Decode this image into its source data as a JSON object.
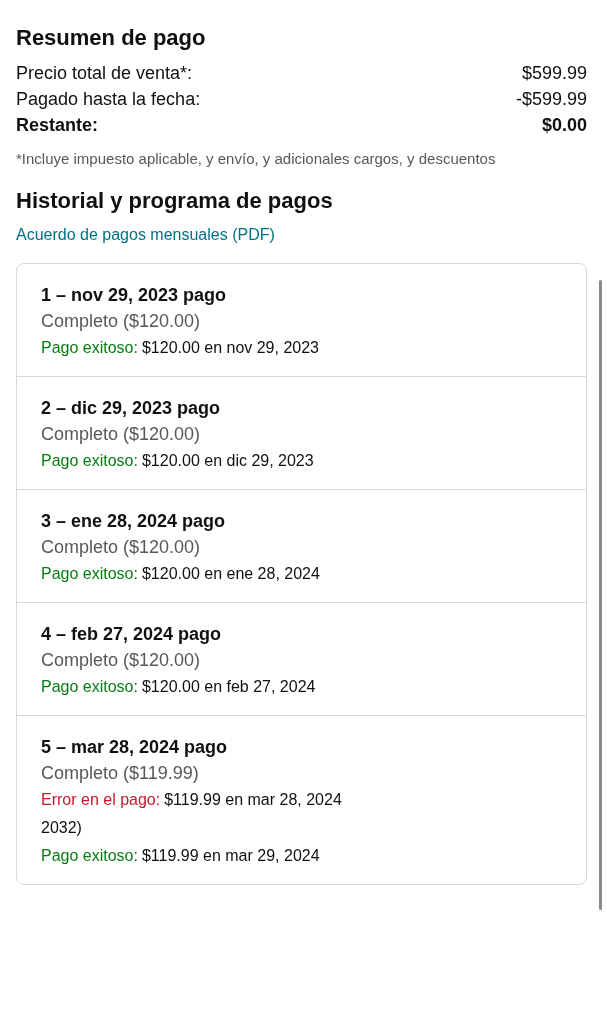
{
  "summary": {
    "title": "Resumen de pago",
    "rows": [
      {
        "label": "Precio total de venta*:",
        "value": "$599.99",
        "bold": false
      },
      {
        "label": "Pagado hasta la fecha:",
        "value": "-$599.99",
        "bold": false
      },
      {
        "label": "Restante:",
        "value": "$0.00",
        "bold": true
      }
    ],
    "footnote": "*Incluye impuesto aplicable, y envío, y adicionales cargos, y descuentos"
  },
  "history": {
    "title": "Historial y programa de pagos",
    "link": "Acuerdo de pagos mensuales (PDF)",
    "payments": [
      {
        "title": "1 – nov 29, 2023 pago",
        "status": "Completo ($120.00)",
        "events": [
          {
            "kind": "success",
            "label": "Pago exitoso:",
            "detail": "$120.00 en nov 29, 2023"
          }
        ]
      },
      {
        "title": "2 – dic 29, 2023 pago",
        "status": "Completo ($120.00)",
        "events": [
          {
            "kind": "success",
            "label": "Pago exitoso:",
            "detail": "$120.00 en dic 29, 2023"
          }
        ]
      },
      {
        "title": "3 – ene 28, 2024 pago",
        "status": "Completo ($120.00)",
        "events": [
          {
            "kind": "success",
            "label": "Pago exitoso:",
            "detail": "$120.00 en ene 28, 2024"
          }
        ]
      },
      {
        "title": "4 – feb 27, 2024 pago",
        "status": "Completo ($120.00)",
        "events": [
          {
            "kind": "success",
            "label": "Pago exitoso:",
            "detail": "$120.00 en feb 27, 2024"
          }
        ]
      },
      {
        "title": "5 – mar 28, 2024 pago",
        "status": "Completo ($119.99)",
        "events": [
          {
            "kind": "error",
            "label": "Error en el pago:",
            "detail": "$119.99 en mar 28, 2024"
          },
          {
            "kind": "note",
            "detail": "2032)"
          },
          {
            "kind": "success",
            "label": "Pago exitoso:",
            "detail": "$119.99 en mar 29, 2024"
          }
        ]
      }
    ]
  }
}
